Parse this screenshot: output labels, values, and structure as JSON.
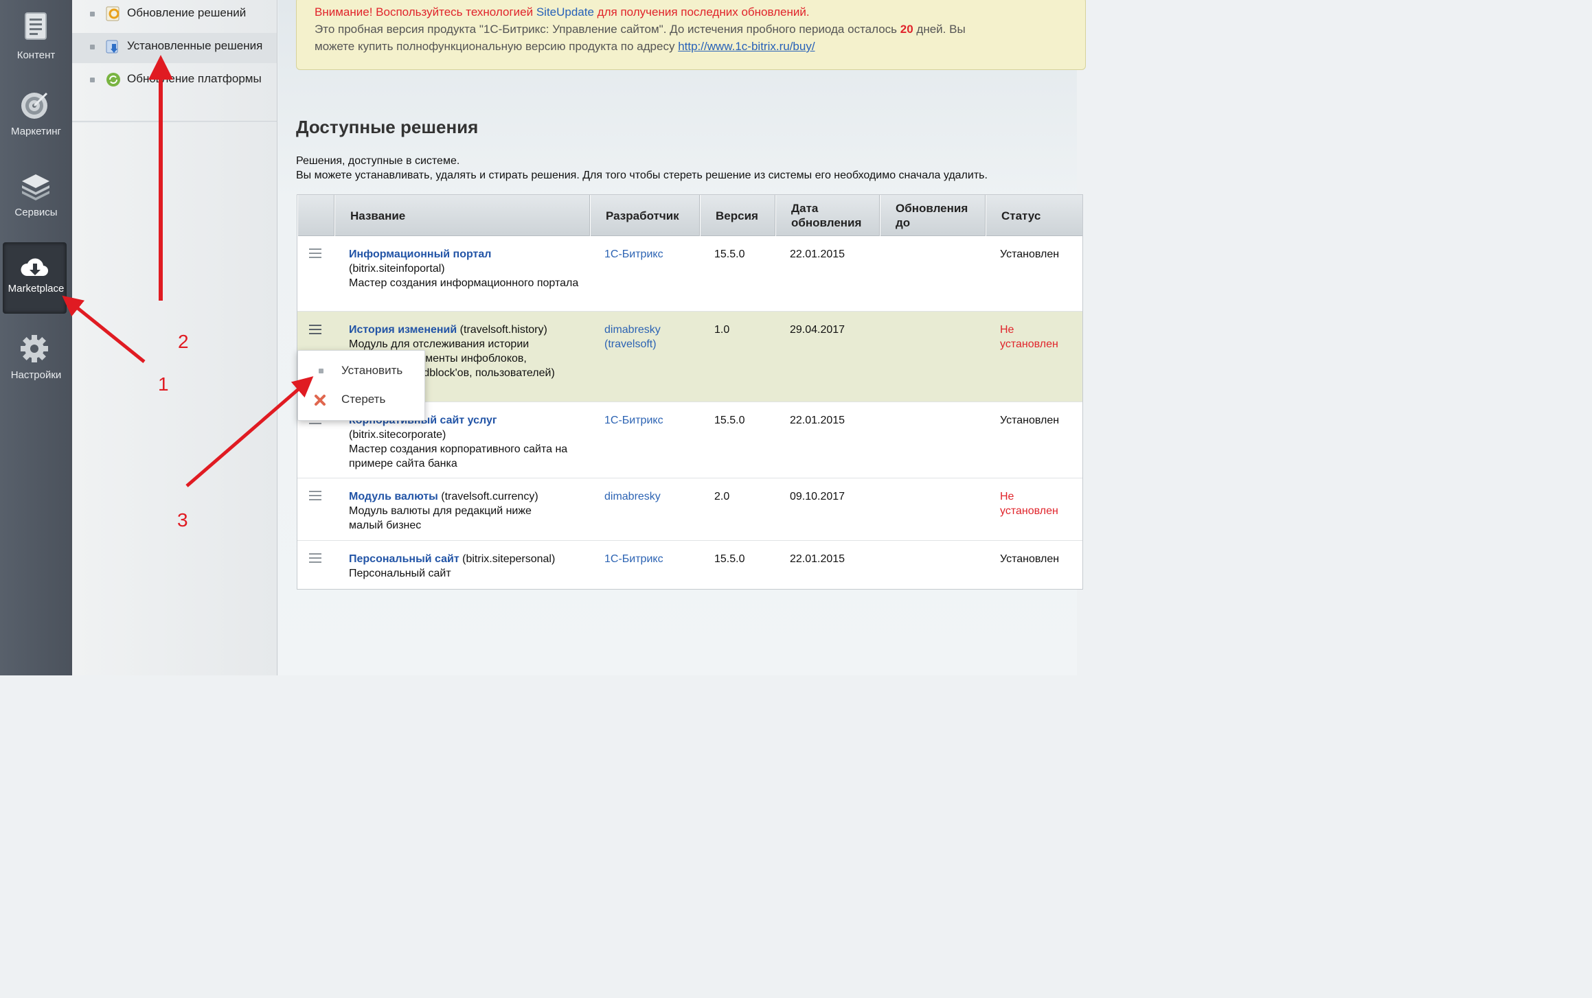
{
  "leftnav": {
    "items": [
      {
        "label": "Контент",
        "icon": "document-icon"
      },
      {
        "label": "Маркетинг",
        "icon": "target-icon"
      },
      {
        "label": "Сервисы",
        "icon": "layers-icon"
      },
      {
        "label": "Marketplace",
        "icon": "cloud-download-icon",
        "active": true
      },
      {
        "label": "Настройки",
        "icon": "gear-icon"
      }
    ]
  },
  "submenu": {
    "items": [
      {
        "label": "Обновление решений"
      },
      {
        "label": "Установленные решения",
        "active": true
      },
      {
        "label": "Обновление платформы"
      }
    ]
  },
  "notice": {
    "warn_prefix": "Внимание! Воспользуйтесь технологией ",
    "warn_link": "SiteUpdate",
    "warn_suffix": " для получения последних обновлений.",
    "line2_a": "Это пробная версия продукта \"1С-Битрикс: Управление сайтом\". До истечения пробного периода осталось ",
    "days": "20",
    "line2_b": " дней. Вы",
    "line3": "можете купить полнофункциональную версию продукта по адресу ",
    "buy_link": "http://www.1c-bitrix.ru/buy/"
  },
  "main": {
    "title": "Доступные решения",
    "desc1": "Решения, доступные в системе.",
    "desc2": "Вы можете устанавливать, удалять и стирать решения. Для того чтобы стереть решение из системы его необходимо сначала удалить."
  },
  "table": {
    "headers": {
      "name": "Название",
      "dev": "Разработчик",
      "version": "Версия",
      "date": "Дата обновления",
      "updates": "Обновления до",
      "status": "Статус"
    },
    "rows": [
      {
        "title": "Информационный портал",
        "code": "(bitrix.siteinfoportal)",
        "desc": "Мастер создания информационного портала",
        "dev": "1С-Битрикс",
        "version": "15.5.0",
        "date": "22.01.2015",
        "updates": "",
        "status": "Установлен"
      },
      {
        "title": "История изменений",
        "code": "(travelsoft.history)",
        "desc": "Модуль для отслеживания истории изменений элементы инфоблоков, разделов, hloadblock'ов, пользователей)",
        "dev": "dimabresky (travelsoft)",
        "version": "1.0",
        "date": "29.04.2017",
        "updates": "",
        "status": "Не установлен"
      },
      {
        "title": "Корпоративный сайт услуг",
        "code": "(bitrix.sitecorporate)",
        "desc": "Мастер создания корпоративного сайта на примере сайта банка",
        "dev": "1С-Битрикс",
        "version": "15.5.0",
        "date": "22.01.2015",
        "updates": "",
        "status": "Установлен"
      },
      {
        "title": "Модуль валюты",
        "code": "(travelsoft.currency)",
        "desc": "Модуль валюты для редакций ниже малый бизнес",
        "dev": "dimabresky",
        "version": "2.0",
        "date": "09.10.2017",
        "updates": "",
        "status": "Не установлен"
      },
      {
        "title": "Персональный сайт",
        "code": "(bitrix.sitepersonal)",
        "desc": "Персональный сайт",
        "dev": "1С-Битрикс",
        "version": "15.5.0",
        "date": "22.01.2015",
        "updates": "",
        "status": "Установлен"
      }
    ]
  },
  "popup": {
    "install": "Установить",
    "erase": "Стереть"
  },
  "annotations": {
    "n1": "1",
    "n2": "2",
    "n3": "3",
    "color": "#e01b22"
  }
}
